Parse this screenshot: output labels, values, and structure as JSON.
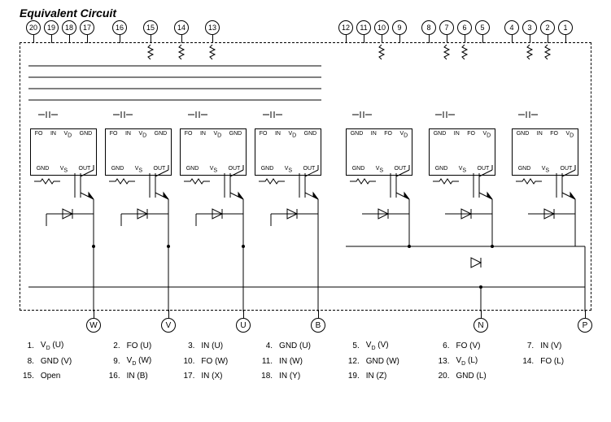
{
  "title": "Equivalent Circuit",
  "top_pins": [
    "20",
    "19",
    "18",
    "17",
    "16",
    "15",
    "14",
    "13",
    "12",
    "11",
    "10",
    "9",
    "8",
    "7",
    "6",
    "5",
    "4",
    "3",
    "2",
    "1"
  ],
  "bottom_pins": [
    "W",
    "V",
    "U",
    "B",
    "N",
    "P"
  ],
  "driver_labels_high": {
    "top": [
      "FO",
      "IN",
      "V_D",
      "GND"
    ],
    "bot": [
      "GND",
      "V_S",
      "OUT"
    ]
  },
  "driver_labels_low": {
    "top": [
      "GND",
      "IN",
      "FO",
      "V_D"
    ],
    "bot": [
      "GND",
      "V_S",
      "OUT"
    ]
  },
  "legend": [
    {
      "n": "1.",
      "v": "V_D (U)"
    },
    {
      "n": "2.",
      "v": "FO (U)"
    },
    {
      "n": "3.",
      "v": "IN (U)"
    },
    {
      "n": "4.",
      "v": "GND (U)"
    },
    {
      "n": "5.",
      "v": "V_D (V)"
    },
    {
      "n": "6.",
      "v": "FO (V)"
    },
    {
      "n": "7.",
      "v": "IN (V)"
    },
    {
      "n": "8.",
      "v": "GND (V)"
    },
    {
      "n": "9.",
      "v": "V_D (W)"
    },
    {
      "n": "10.",
      "v": "FO (W)"
    },
    {
      "n": "11.",
      "v": "IN (W)"
    },
    {
      "n": "12.",
      "v": "GND (W)"
    },
    {
      "n": "13.",
      "v": "V_D (L)"
    },
    {
      "n": "14.",
      "v": "FO (L)"
    },
    {
      "n": "15.",
      "v": "Open"
    },
    {
      "n": "16.",
      "v": "IN (B)"
    },
    {
      "n": "17.",
      "v": "IN (X)"
    },
    {
      "n": "18.",
      "v": "IN (Y)"
    },
    {
      "n": "19.",
      "v": "IN (Z)"
    },
    {
      "n": "20.",
      "v": "GND (L)"
    }
  ]
}
